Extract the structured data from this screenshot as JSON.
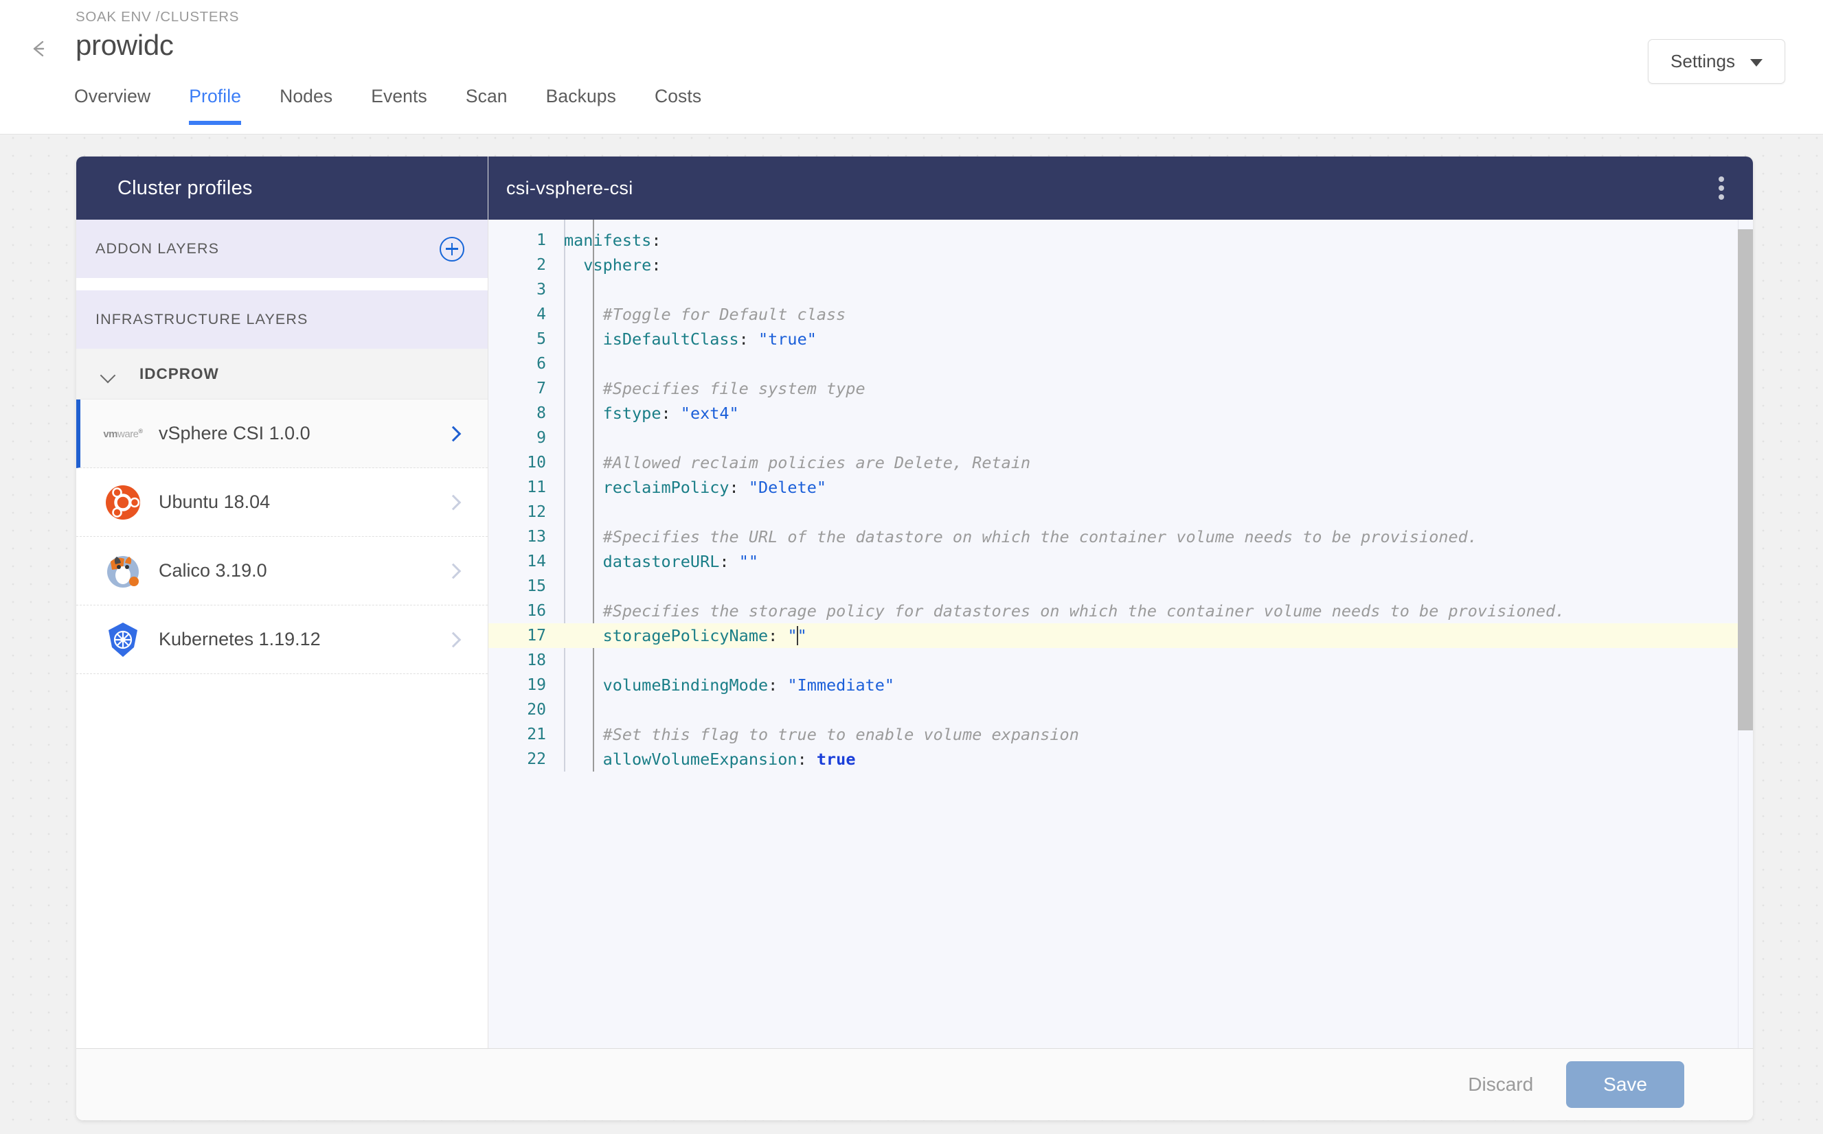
{
  "header": {
    "breadcrumb": "SOAK ENV /CLUSTERS",
    "title": "prowidc",
    "back_icon": "back-arrow-icon",
    "settings_label": "Settings",
    "tabs": [
      {
        "label": "Overview",
        "active": false
      },
      {
        "label": "Profile",
        "active": true
      },
      {
        "label": "Nodes",
        "active": false
      },
      {
        "label": "Events",
        "active": false
      },
      {
        "label": "Scan",
        "active": false
      },
      {
        "label": "Backups",
        "active": false
      },
      {
        "label": "Costs",
        "active": false
      }
    ]
  },
  "sidebar": {
    "title": "Cluster profiles",
    "sections": [
      {
        "label": "ADDON LAYERS",
        "has_add": true
      },
      {
        "label": "INFRASTRUCTURE LAYERS",
        "has_add": false
      }
    ],
    "group": {
      "label": "IDCPROW",
      "expanded": true
    },
    "layers": [
      {
        "label": "vSphere CSI 1.0.0",
        "icon": "vmware-logo-icon",
        "selected": true
      },
      {
        "label": "Ubuntu 18.04",
        "icon": "ubuntu-logo-icon",
        "selected": false
      },
      {
        "label": "Calico 3.19.0",
        "icon": "calico-logo-icon",
        "selected": false
      },
      {
        "label": "Kubernetes 1.19.12",
        "icon": "kubernetes-logo-icon",
        "selected": false
      }
    ]
  },
  "editor": {
    "title": "csi-vsphere-csi",
    "menu_icon": "kebab-menu-icon",
    "language": "yaml",
    "highlighted_line": 17,
    "cursor_line": 17,
    "lines": [
      {
        "n": 1,
        "indent": 0,
        "tokens": [
          {
            "t": "key",
            "v": "manifests"
          },
          {
            "t": "colon",
            "v": ":"
          }
        ]
      },
      {
        "n": 2,
        "indent": 1,
        "tokens": [
          {
            "t": "key",
            "v": "vsphere"
          },
          {
            "t": "colon",
            "v": ":"
          }
        ]
      },
      {
        "n": 3,
        "indent": 2,
        "tokens": []
      },
      {
        "n": 4,
        "indent": 2,
        "tokens": [
          {
            "t": "comment",
            "v": "#Toggle for Default class"
          }
        ]
      },
      {
        "n": 5,
        "indent": 2,
        "tokens": [
          {
            "t": "key",
            "v": "isDefaultClass"
          },
          {
            "t": "colon",
            "v": ":"
          },
          {
            "t": "space",
            "v": " "
          },
          {
            "t": "string",
            "v": "\"true\""
          }
        ]
      },
      {
        "n": 6,
        "indent": 2,
        "tokens": []
      },
      {
        "n": 7,
        "indent": 2,
        "tokens": [
          {
            "t": "comment",
            "v": "#Specifies file system type"
          }
        ]
      },
      {
        "n": 8,
        "indent": 2,
        "tokens": [
          {
            "t": "key",
            "v": "fstype"
          },
          {
            "t": "colon",
            "v": ":"
          },
          {
            "t": "space",
            "v": " "
          },
          {
            "t": "string",
            "v": "\"ext4\""
          }
        ]
      },
      {
        "n": 9,
        "indent": 2,
        "tokens": []
      },
      {
        "n": 10,
        "indent": 2,
        "tokens": [
          {
            "t": "comment",
            "v": "#Allowed reclaim policies are Delete, Retain"
          }
        ]
      },
      {
        "n": 11,
        "indent": 2,
        "tokens": [
          {
            "t": "key",
            "v": "reclaimPolicy"
          },
          {
            "t": "colon",
            "v": ":"
          },
          {
            "t": "space",
            "v": " "
          },
          {
            "t": "string",
            "v": "\"Delete\""
          }
        ]
      },
      {
        "n": 12,
        "indent": 2,
        "tokens": []
      },
      {
        "n": 13,
        "indent": 2,
        "tokens": [
          {
            "t": "comment",
            "v": "#Specifies the URL of the datastore on which the container volume needs to be provisioned."
          }
        ]
      },
      {
        "n": 14,
        "indent": 2,
        "tokens": [
          {
            "t": "key",
            "v": "datastoreURL"
          },
          {
            "t": "colon",
            "v": ":"
          },
          {
            "t": "space",
            "v": " "
          },
          {
            "t": "string",
            "v": "\"\""
          }
        ]
      },
      {
        "n": 15,
        "indent": 2,
        "tokens": []
      },
      {
        "n": 16,
        "indent": 2,
        "tokens": [
          {
            "t": "comment",
            "v": "#Specifies the storage policy for datastores on which the container volume needs to be provisioned."
          }
        ]
      },
      {
        "n": 17,
        "indent": 2,
        "tokens": [
          {
            "t": "key",
            "v": "storagePolicyName"
          },
          {
            "t": "colon",
            "v": ":"
          },
          {
            "t": "space",
            "v": " "
          },
          {
            "t": "string",
            "v": "\""
          },
          {
            "t": "caret",
            "v": ""
          },
          {
            "t": "string",
            "v": "\""
          }
        ]
      },
      {
        "n": 18,
        "indent": 2,
        "tokens": []
      },
      {
        "n": 19,
        "indent": 2,
        "tokens": [
          {
            "t": "key",
            "v": "volumeBindingMode"
          },
          {
            "t": "colon",
            "v": ":"
          },
          {
            "t": "space",
            "v": " "
          },
          {
            "t": "string",
            "v": "\"Immediate\""
          }
        ]
      },
      {
        "n": 20,
        "indent": 2,
        "tokens": []
      },
      {
        "n": 21,
        "indent": 2,
        "tokens": [
          {
            "t": "comment",
            "v": "#Set this flag to true to enable volume expansion"
          }
        ]
      },
      {
        "n": 22,
        "indent": 2,
        "tokens": [
          {
            "t": "key",
            "v": "allowVolumeExpansion"
          },
          {
            "t": "colon",
            "v": ":"
          },
          {
            "t": "space",
            "v": " "
          },
          {
            "t": "bool",
            "v": "true"
          }
        ]
      }
    ]
  },
  "footer": {
    "discard_label": "Discard",
    "save_label": "Save"
  },
  "colors": {
    "accent_blue": "#3b7df6",
    "header_navy": "#333a63",
    "section_lavender": "#ebe9f7",
    "save_button": "#86a8d1",
    "selected_border": "#1f5fd0",
    "highlight_line": "#fdfce4",
    "code_key": "#1a7e87",
    "code_string": "#1b5fd9",
    "code_comment": "#9b9b9b"
  }
}
